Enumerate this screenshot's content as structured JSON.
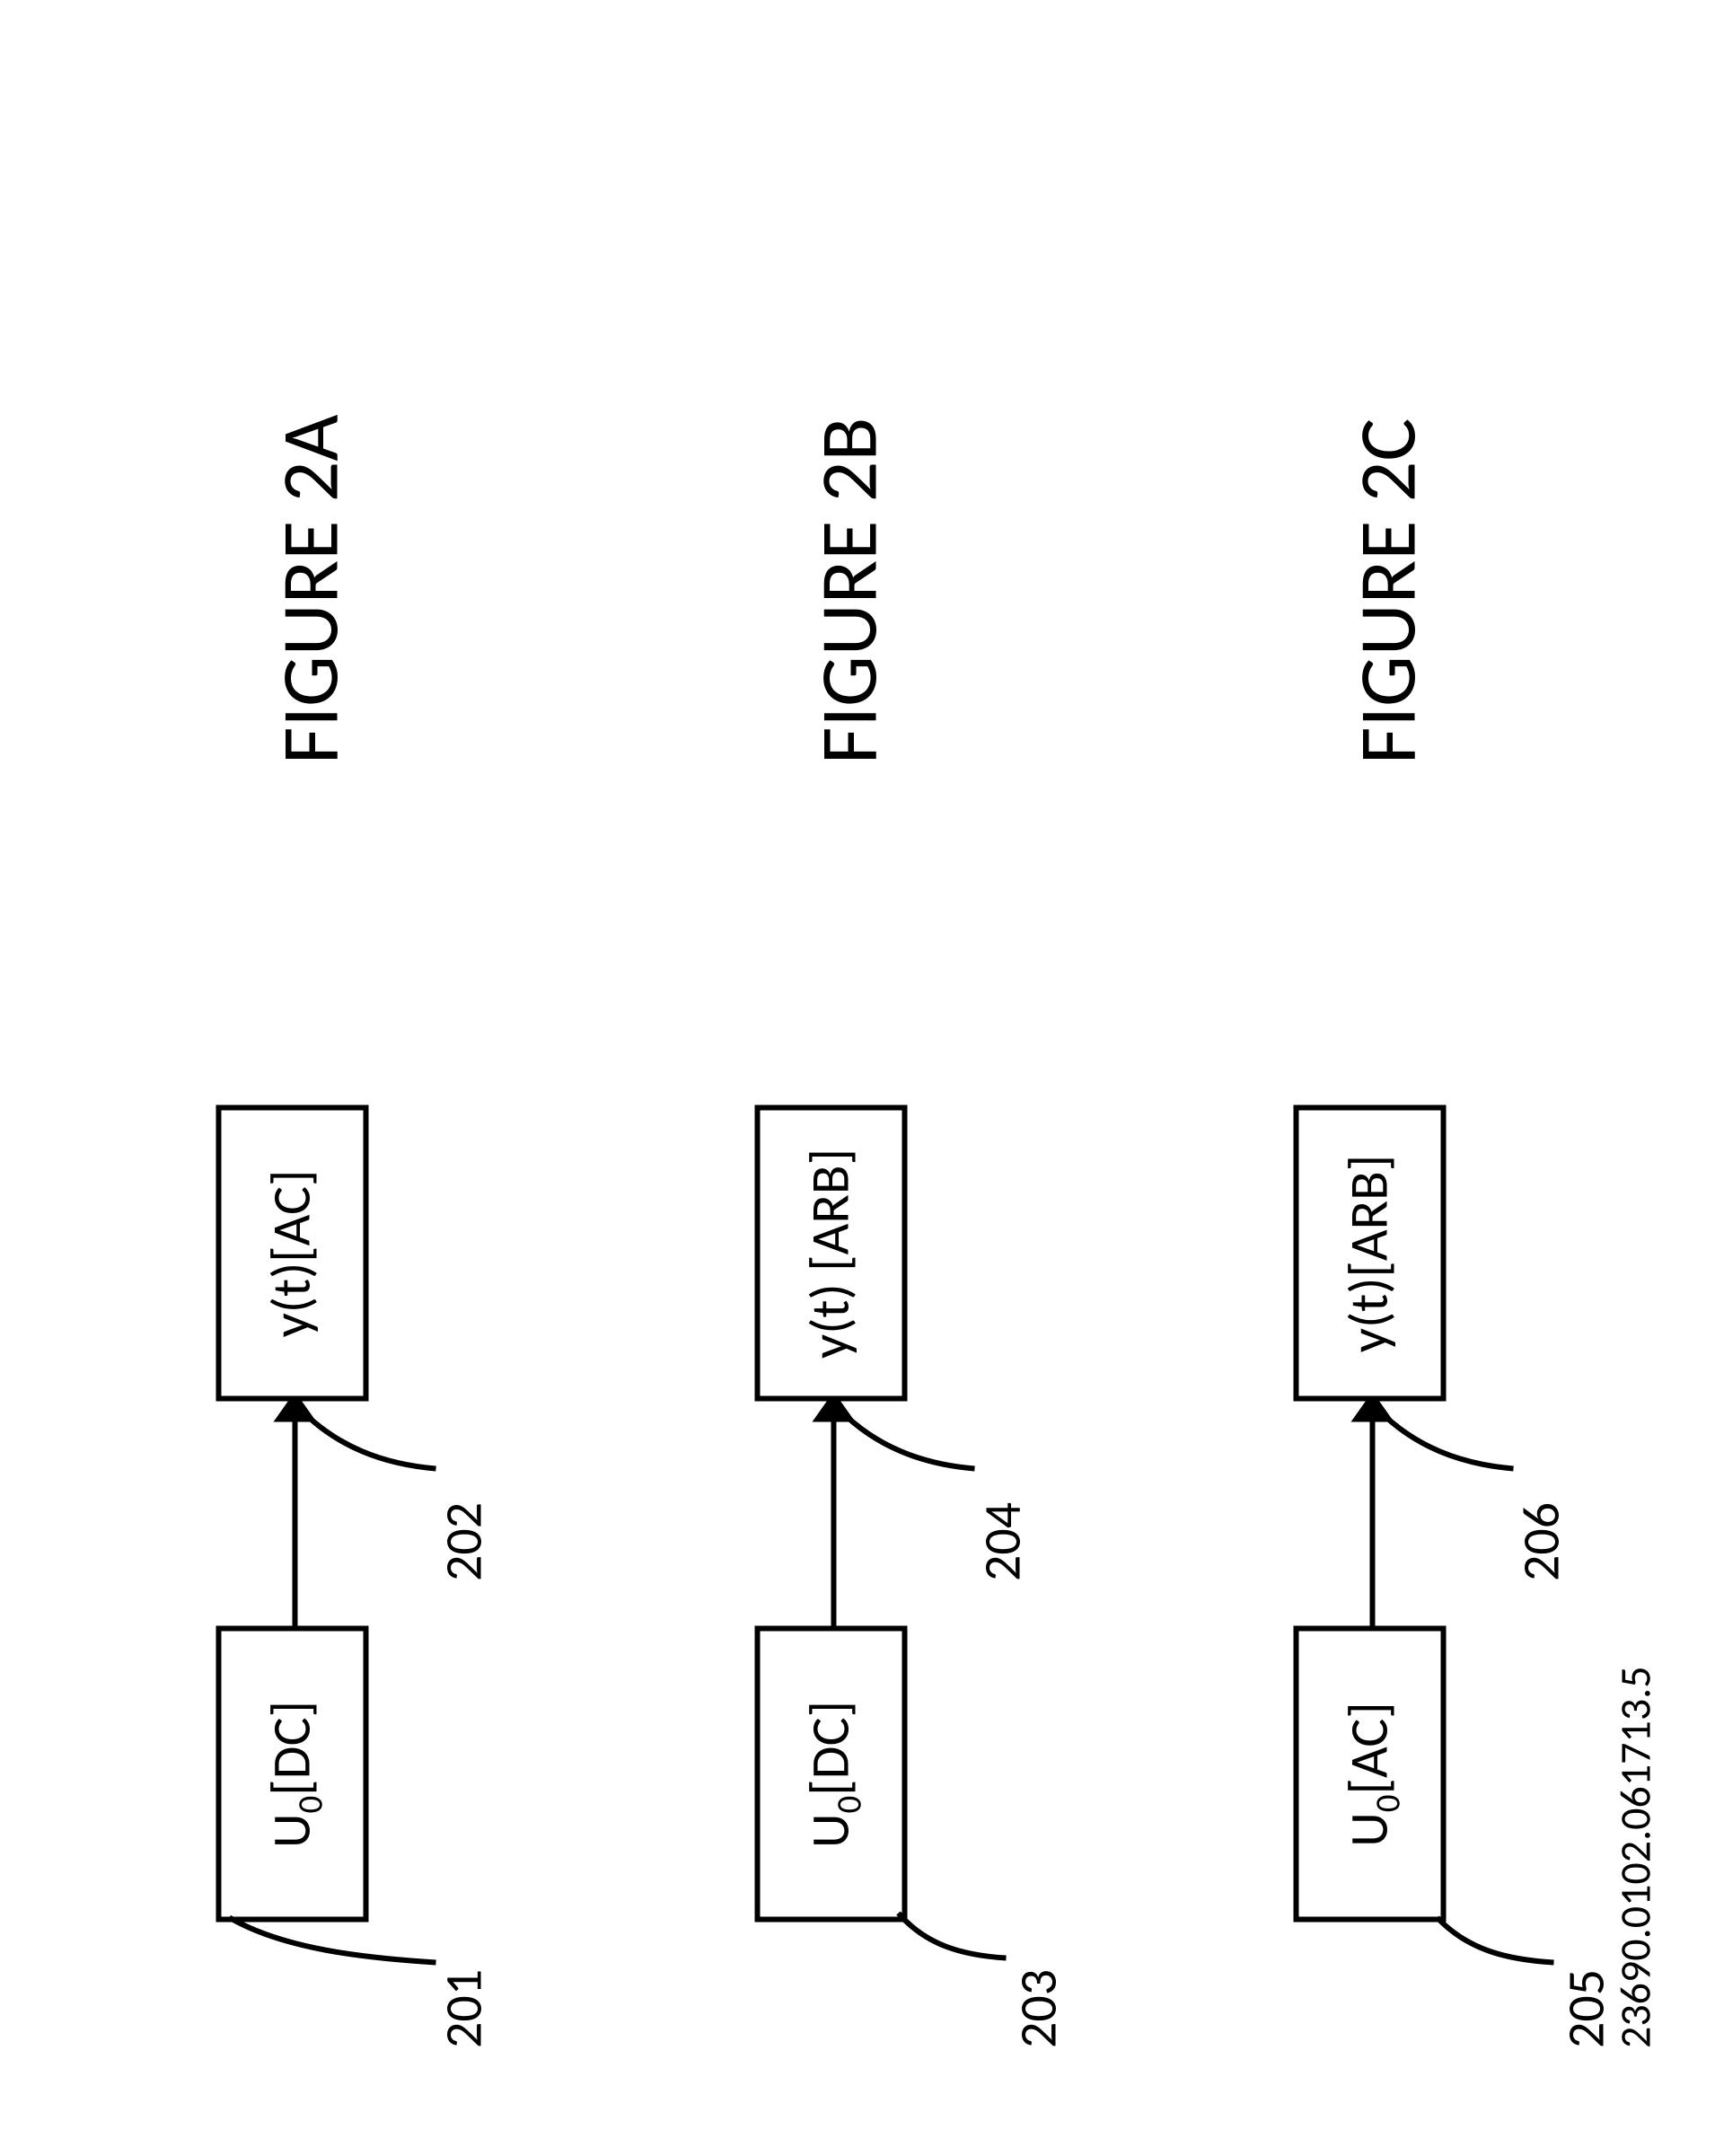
{
  "figures": {
    "a": {
      "title": "FIGURE 2A",
      "left_box_prefix": "U",
      "left_box_sub": "0",
      "left_box_suffix": "[DC]",
      "right_box": "y(t)[AC]",
      "ref_left": "201",
      "ref_right": "202"
    },
    "b": {
      "title": "FIGURE 2B",
      "left_box_prefix": "U",
      "left_box_sub": "0",
      "left_box_suffix": "[DC]",
      "right_box": "y(t) [ARB]",
      "ref_left": "203",
      "ref_right": "204"
    },
    "c": {
      "title": "FIGURE 2C",
      "left_box_prefix": "U",
      "left_box_sub": "0",
      "left_box_suffix": "[AC]",
      "right_box": "y(t)[ARB]",
      "ref_left": "205",
      "ref_right": "206"
    }
  },
  "footer": "23690.0102.061713.5"
}
